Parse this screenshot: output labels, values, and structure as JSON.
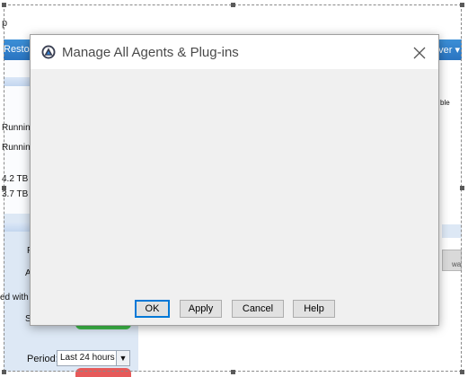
{
  "background": {
    "crumb": "p",
    "toolbar_left": "Resto",
    "toolbar_right": "rver ▾",
    "left_texts": [
      "Runnin",
      "Runnin",
      "4.2 TB",
      "3.7 TB",
      "F",
      "A",
      "ed with",
      "S"
    ],
    "period_label": "Period:",
    "period_value": "Last 24 hours",
    "right_text_1": "ble",
    "right_text_2": "wa"
  },
  "dialog": {
    "title": "Manage All Agents & Plug-ins",
    "buttons": {
      "ok": "OK",
      "apply": "Apply",
      "cancel": "Cancel",
      "help": "Help"
    }
  },
  "colors": {
    "toolbar": "#2a74c1",
    "dialog_body": "#f0f0f0",
    "default_button_border": "#0078d7"
  }
}
